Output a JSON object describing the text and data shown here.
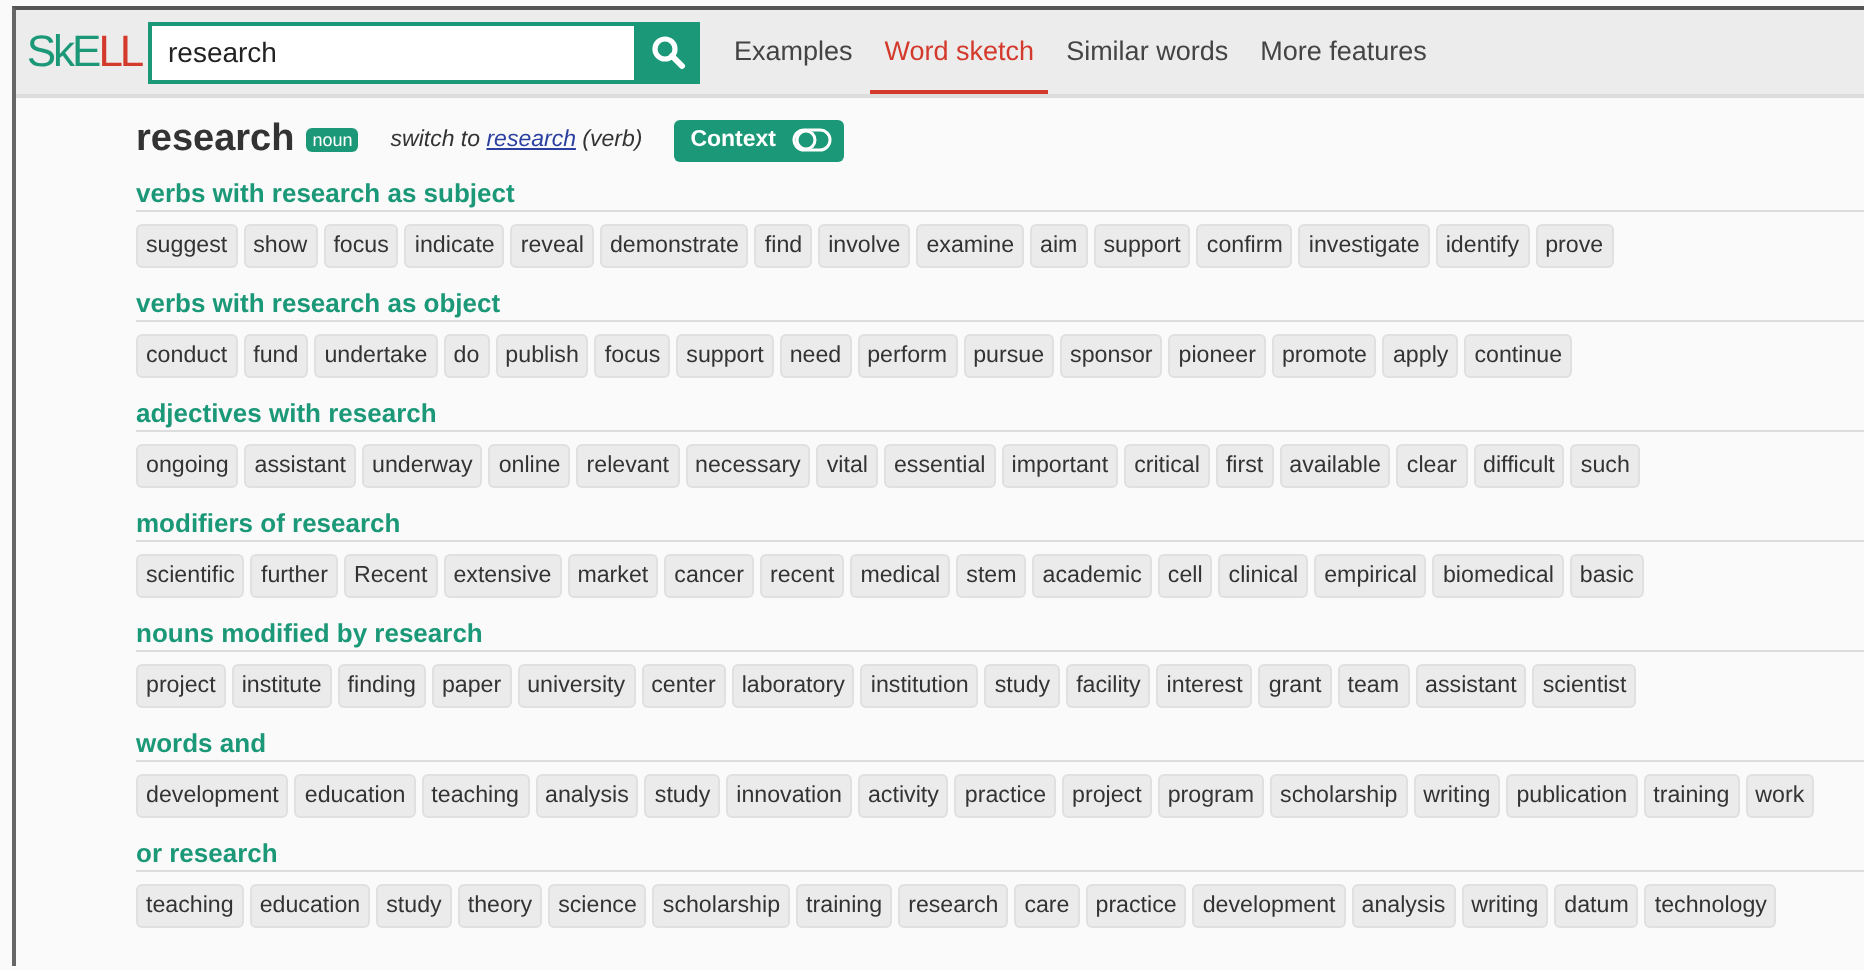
{
  "header": {
    "logo_parts": [
      "SkE",
      "LL"
    ],
    "search": {
      "value": "research"
    },
    "nav": [
      {
        "label": "Examples",
        "selected": false
      },
      {
        "label": "Word sketch",
        "selected": true
      },
      {
        "label": "Similar words",
        "selected": false
      },
      {
        "label": "More features",
        "selected": false
      }
    ]
  },
  "headword": {
    "word": "research",
    "pos": "noun",
    "switch_text": "switch to",
    "switch_link": "research",
    "switch_pos": "(verb)",
    "context_button": {
      "label": "Context",
      "on": false
    }
  },
  "sections": [
    {
      "title": "verbs with research as subject",
      "words": [
        "suggest",
        "show",
        "focus",
        "indicate",
        "reveal",
        "demonstrate",
        "find",
        "involve",
        "examine",
        "aim",
        "support",
        "confirm",
        "investigate",
        "identify",
        "prove"
      ]
    },
    {
      "title": "verbs with research as object",
      "words": [
        "conduct",
        "fund",
        "undertake",
        "do",
        "publish",
        "focus",
        "support",
        "need",
        "perform",
        "pursue",
        "sponsor",
        "pioneer",
        "promote",
        "apply",
        "continue"
      ]
    },
    {
      "title": "adjectives with research",
      "words": [
        "ongoing",
        "assistant",
        "underway",
        "online",
        "relevant",
        "necessary",
        "vital",
        "essential",
        "important",
        "critical",
        "first",
        "available",
        "clear",
        "difficult",
        "such"
      ]
    },
    {
      "title": "modifiers of research",
      "words": [
        "scientific",
        "further",
        "Recent",
        "extensive",
        "market",
        "cancer",
        "recent",
        "medical",
        "stem",
        "academic",
        "cell",
        "clinical",
        "empirical",
        "biomedical",
        "basic"
      ]
    },
    {
      "title": "nouns modified by research",
      "words": [
        "project",
        "institute",
        "finding",
        "paper",
        "university",
        "center",
        "laboratory",
        "institution",
        "study",
        "facility",
        "interest",
        "grant",
        "team",
        "assistant",
        "scientist"
      ]
    },
    {
      "title": "words and",
      "words": [
        "development",
        "education",
        "teaching",
        "analysis",
        "study",
        "innovation",
        "activity",
        "practice",
        "project",
        "program",
        "scholarship",
        "writing",
        "publication",
        "training",
        "work"
      ]
    },
    {
      "title": "or research",
      "words": [
        "teaching",
        "education",
        "study",
        "theory",
        "science",
        "scholarship",
        "training",
        "research",
        "care",
        "practice",
        "development",
        "analysis",
        "writing",
        "datum",
        "technology"
      ]
    }
  ]
}
